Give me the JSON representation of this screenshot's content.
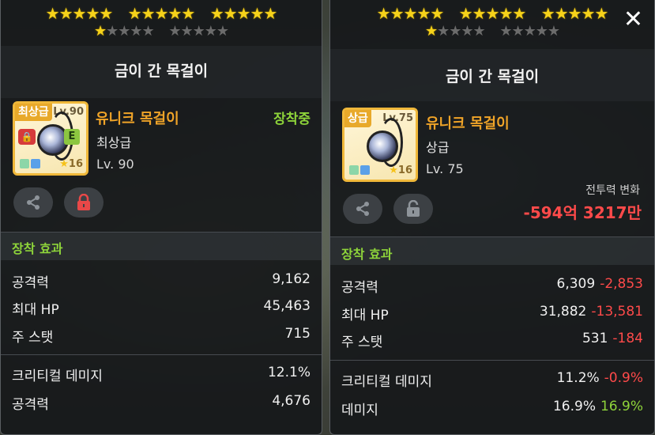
{
  "left": {
    "star_rows": {
      "row1": [
        "★★★★★",
        "★★★★★",
        "★★★★★"
      ],
      "row2_on": "★",
      "row2_off": "★★★★",
      "row2_off2": "★★★★★"
    },
    "item_name": "금이 간 목걸이",
    "grade_tag": "최상급",
    "icon_level": "Lv.90",
    "e_badge": "E",
    "star_force": "16",
    "item_type": "유니크 목걸이",
    "grade": "최상급",
    "level": "Lv. 90",
    "equipped": "장착중",
    "section": "장착 효과",
    "stats": [
      {
        "name": "공격력",
        "value": "9,162"
      },
      {
        "name": "최대 HP",
        "value": "45,463"
      },
      {
        "name": "주 스탯",
        "value": "715"
      },
      {
        "name": "크리티컬 데미지",
        "value": "12.1%"
      },
      {
        "name": "공격력",
        "value": "4,676"
      }
    ],
    "share_icon": "share-icon",
    "lock_icon": "lock-icon"
  },
  "right": {
    "star_rows": {
      "row1": [
        "★★★★★",
        "★★★★★",
        "★★★★★"
      ],
      "row2_on": "★",
      "row2_off": "★★★★",
      "row2_off2": "★★★★★"
    },
    "close_label": "✕",
    "item_name": "금이 간 목걸이",
    "grade_tag": "상급",
    "icon_level": "Lv.75",
    "star_force": "16",
    "item_type": "유니크 목걸이",
    "grade": "상급",
    "level": "Lv. 75",
    "cp_label": "전투력 변화",
    "cp_value": "-594억 3217만",
    "section": "장착 효과",
    "stats": [
      {
        "name": "공격력",
        "value": "6,309",
        "diff": "-2,853",
        "diff_type": "neg"
      },
      {
        "name": "최대 HP",
        "value": "31,882",
        "diff": "-13,581",
        "diff_type": "neg"
      },
      {
        "name": "주 스탯",
        "value": "531",
        "diff": "-184",
        "diff_type": "neg"
      },
      {
        "name": "크리티컬 데미지",
        "value": "11.2%",
        "diff": "-0.9%",
        "diff_type": "neg"
      },
      {
        "name": "데미지",
        "value": "16.9%",
        "diff": "16.9%",
        "diff_type": "pos"
      }
    ],
    "share_icon": "share-icon",
    "lock_icon": "unlock-icon"
  },
  "colors": {
    "accent_gold": "#f0a428",
    "equipped_green": "#8ed43a",
    "negative_red": "#ff4a4a",
    "star_gold": "#f6d21a"
  }
}
